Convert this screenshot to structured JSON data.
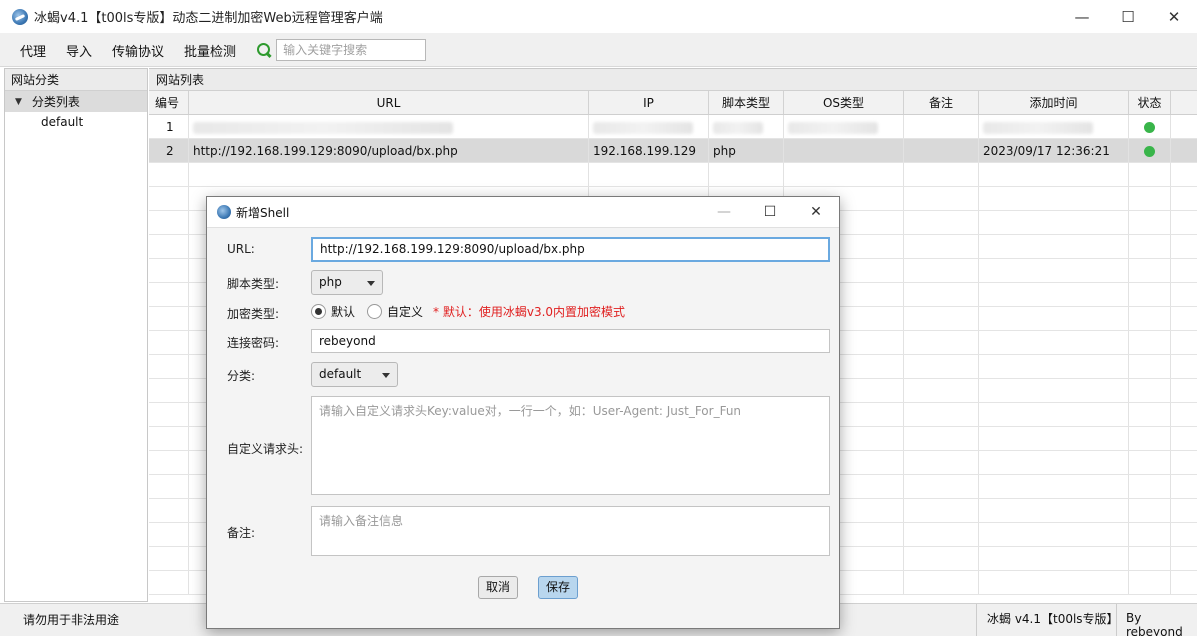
{
  "window": {
    "title": "冰蝎v4.1【t00ls专版】动态二进制加密Web远程管理客户端",
    "minimize": "—",
    "maximize": "☐",
    "close": "✕"
  },
  "menu": {
    "items": [
      "代理",
      "导入",
      "传输协议",
      "批量检测"
    ],
    "search_placeholder": "输入关键字搜索"
  },
  "left_panel": {
    "header": "网站分类",
    "root_label": "分类列表",
    "children": [
      "default"
    ]
  },
  "right_panel": {
    "header": "网站列表",
    "columns": [
      "编号",
      "URL",
      "IP",
      "脚本类型",
      "OS类型",
      "备注",
      "添加时间",
      "状态"
    ],
    "rows": [
      {
        "id": "1",
        "url": "",
        "ip": "",
        "type": "",
        "os": "",
        "note": "",
        "time": "",
        "status_color": "#39b54a"
      },
      {
        "id": "2",
        "url": "http://192.168.199.129:8090/upload/bx.php",
        "ip": "192.168.199.129",
        "type": "php",
        "os": "",
        "note": "",
        "time": "2023/09/17 12:36:21",
        "status_color": "#39b54a"
      }
    ]
  },
  "statusbar": {
    "left": "请勿用于非法用途",
    "version": "冰蝎 v4.1【t00ls专版】",
    "author": "By rebeyond"
  },
  "dialog": {
    "title": "新增Shell",
    "minimize": "—",
    "maximize": "☐",
    "close": "✕",
    "url_label": "URL:",
    "url_value": "http://192.168.199.129:8090/upload/bx.php",
    "script_label": "脚本类型:",
    "script_value": "php",
    "encrypt_label": "加密类型:",
    "encrypt_default": "默认",
    "encrypt_custom": "自定义",
    "encrypt_hint": "* 默认：使用冰蝎v3.0内置加密模式",
    "password_label": "连接密码:",
    "password_value": "rebeyond",
    "category_label": "分类:",
    "category_value": "default",
    "headers_label": "自定义请求头:",
    "headers_placeholder": "请输入自定义请求头Key:value对，一行一个，如：User-Agent: Just_For_Fun",
    "note_label": "备注:",
    "note_placeholder": "请输入备注信息",
    "cancel": "取消",
    "save": "保存"
  }
}
